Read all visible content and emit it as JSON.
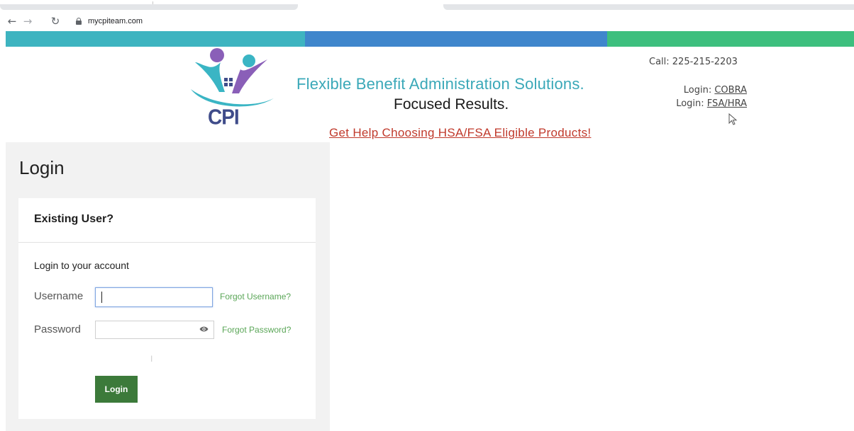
{
  "browser": {
    "back_glyph": "←",
    "forward_glyph": "→",
    "reload_glyph": "↻",
    "url": "mycpiteam.com",
    "icons": [
      "back-arrow-icon",
      "forward-arrow-icon",
      "reload-icon",
      "lock-icon"
    ]
  },
  "brand": {
    "band_colors": [
      "#3eb4c0",
      "#3f86cc",
      "#3dbf7e"
    ],
    "logo_text": "CPI",
    "tagline": "Flexible Benefit Administration Solutions.",
    "subtag": "Focused Results.",
    "help_link": "Get Help Choosing HSA/FSA Eligible Products!"
  },
  "contact": {
    "call": "Call: 225-215-2203",
    "cobra_prefix": "Login: ",
    "cobra_link": "COBRA",
    "fsa_prefix": "Login: ",
    "fsa_link": "FSA/HRA"
  },
  "login": {
    "page_title": "Login",
    "card_header": "Existing User?",
    "card_subtitle": "Login to your account",
    "username_label": "Username",
    "username_value": "",
    "forgot_username": "Forgot Username?",
    "password_label": "Password",
    "password_value": "",
    "forgot_password": "Forgot Password?",
    "submit_label": "Login",
    "accent_color": "#3c7a3a",
    "link_color": "#5aa657"
  }
}
